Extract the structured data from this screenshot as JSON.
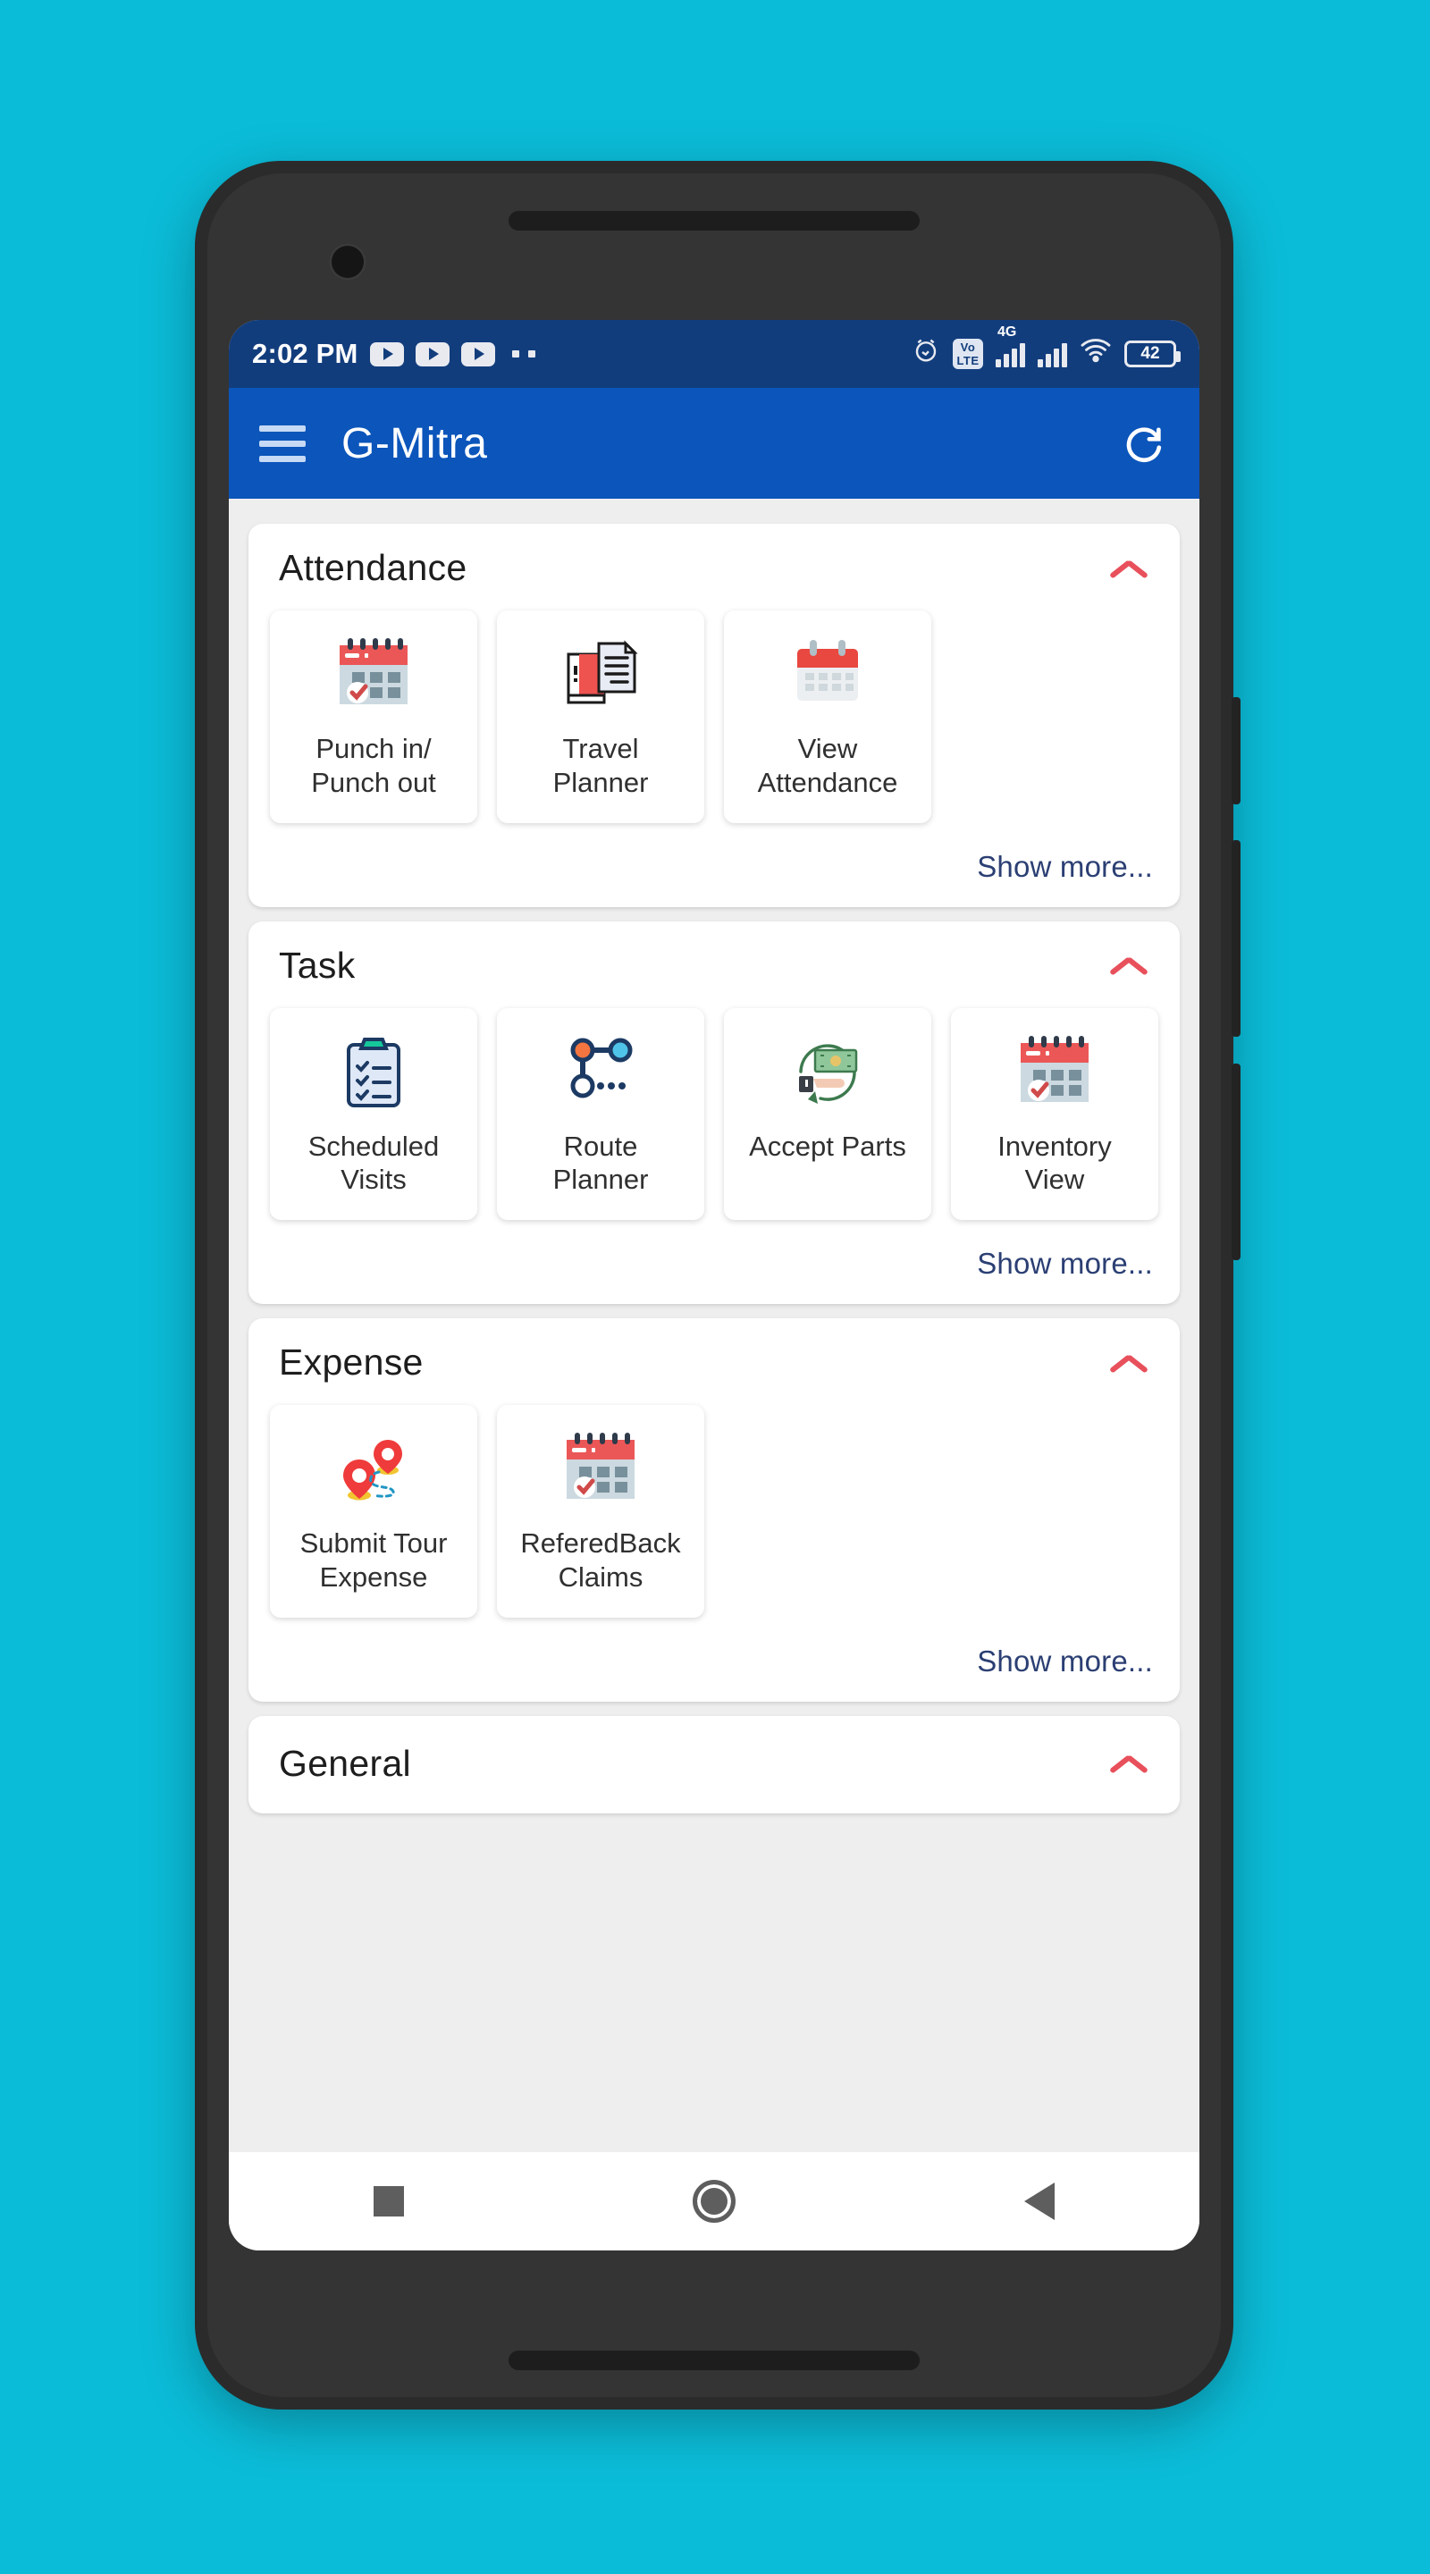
{
  "status_bar": {
    "time": "2:02 PM",
    "notification_icons": [
      "youtube-play-icon",
      "youtube-play-icon",
      "youtube-play-icon"
    ],
    "overflow_dots": "..",
    "alarm_icon": "alarm-clock-icon",
    "volte_top": "Vo",
    "volte_bottom": "LTE",
    "network_type": "4G",
    "wifi_icon": "wifi-icon",
    "battery_level": "42"
  },
  "app_bar": {
    "menu_icon": "hamburger-menu-icon",
    "title": "G-Mitra",
    "refresh_icon": "refresh-icon"
  },
  "sections": [
    {
      "title": "Attendance",
      "collapse_icon": "chevron-up-icon",
      "show_more": "Show more...",
      "tiles": [
        {
          "label": "Punch in/\nPunch out",
          "icon": "calendar-check-icon"
        },
        {
          "label": "Travel\nPlanner",
          "icon": "document-book-icon"
        },
        {
          "label": "View\nAttendance",
          "icon": "calendar-icon"
        }
      ]
    },
    {
      "title": "Task",
      "collapse_icon": "chevron-up-icon",
      "show_more": "Show more...",
      "tiles": [
        {
          "label": "Scheduled\nVisits",
          "icon": "clipboard-checklist-icon"
        },
        {
          "label": "Route\nPlanner",
          "icon": "route-nodes-icon"
        },
        {
          "label": "Accept Parts",
          "icon": "hand-money-return-icon"
        },
        {
          "label": "Inventory\nView",
          "icon": "calendar-check-icon"
        }
      ]
    },
    {
      "title": "Expense",
      "collapse_icon": "chevron-up-icon",
      "show_more": "Show more...",
      "tiles": [
        {
          "label": "Submit Tour\nExpense",
          "icon": "map-pins-route-icon"
        },
        {
          "label": "ReferedBack\nClaims",
          "icon": "calendar-check-icon"
        }
      ]
    },
    {
      "title": "General",
      "collapse_icon": "chevron-up-icon",
      "show_more": "",
      "tiles": []
    }
  ],
  "nav_bar": {
    "recents": "square-recents-icon",
    "home": "circle-home-icon",
    "back": "triangle-back-icon"
  },
  "colors": {
    "background": "#0bbcd8",
    "status_bar": "#123d7d",
    "app_bar": "#0b55bb",
    "accent_red": "#e8505b",
    "link": "#2b3f73"
  }
}
